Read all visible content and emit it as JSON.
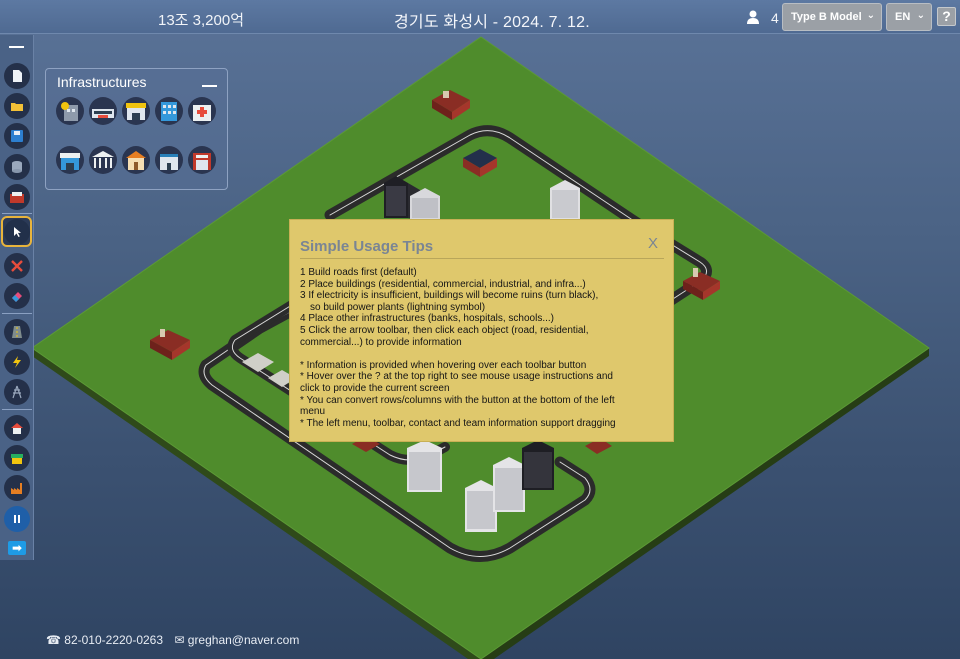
{
  "header": {
    "money": "13조 3,200억",
    "city_date": "경기도 화성시 - 2024. 7. 12.",
    "user_count": "4",
    "model_select": "Type B Model",
    "lang_select": "EN",
    "help_label": "?"
  },
  "toolbar": {
    "icons": [
      "new-file-icon",
      "open-folder-icon",
      "save-icon",
      "database-icon",
      "building-info-icon",
      "pointer-icon",
      "delete-icon",
      "eraser-icon",
      "road-icon",
      "power-plant-icon",
      "power-tower-icon",
      "residential-icon",
      "commercial-icon",
      "industrial-icon",
      "pause-icon",
      "next-arrow-icon"
    ],
    "selected_tool": "pointer-icon"
  },
  "infrastructures": {
    "title": "Infrastructures",
    "items": [
      "bank",
      "bus-terminal",
      "cinema",
      "office",
      "hospital",
      "mall",
      "museum",
      "school",
      "police",
      "fire-station"
    ],
    "item_labels": {
      "cinema": "CINEMA",
      "mall": "MALL",
      "museum": "MUSEUM",
      "school": "SCHOOL",
      "police": "POLICE"
    }
  },
  "tips": {
    "title": "Simple Usage Tips",
    "close_label": "X",
    "lines": [
      "1 Build roads first (default)",
      "2 Place buildings (residential, commercial, industrial, and infra...)",
      "3 If electricity is insufficient, buildings will become ruins (turn black),",
      "so build power plants (lightning symbol)",
      "4 Place other infrastructures (banks, hospitals, schools...)",
      "5 Click the arrow toolbar, then click each object (road, residential,",
      "commercial...) to provide information",
      "",
      "* Information is provided when hovering over each toolbar button",
      "* Hover over the ? at the top right to see mouse usage instructions and",
      "click to provide the current screen",
      "* You can convert rows/columns with the button at the bottom of the left",
      "menu",
      "* The left menu, toolbar, contact and team information support dragging"
    ]
  },
  "footer": {
    "phone": "☎ 82-010-2220-0263",
    "email": "✉ greghan@naver.com"
  },
  "colors": {
    "grass": "#4f8c2c",
    "tips_bg": "#dfc86c",
    "selected_border": "#e8b43c",
    "accent_blue": "#1e9be6"
  }
}
